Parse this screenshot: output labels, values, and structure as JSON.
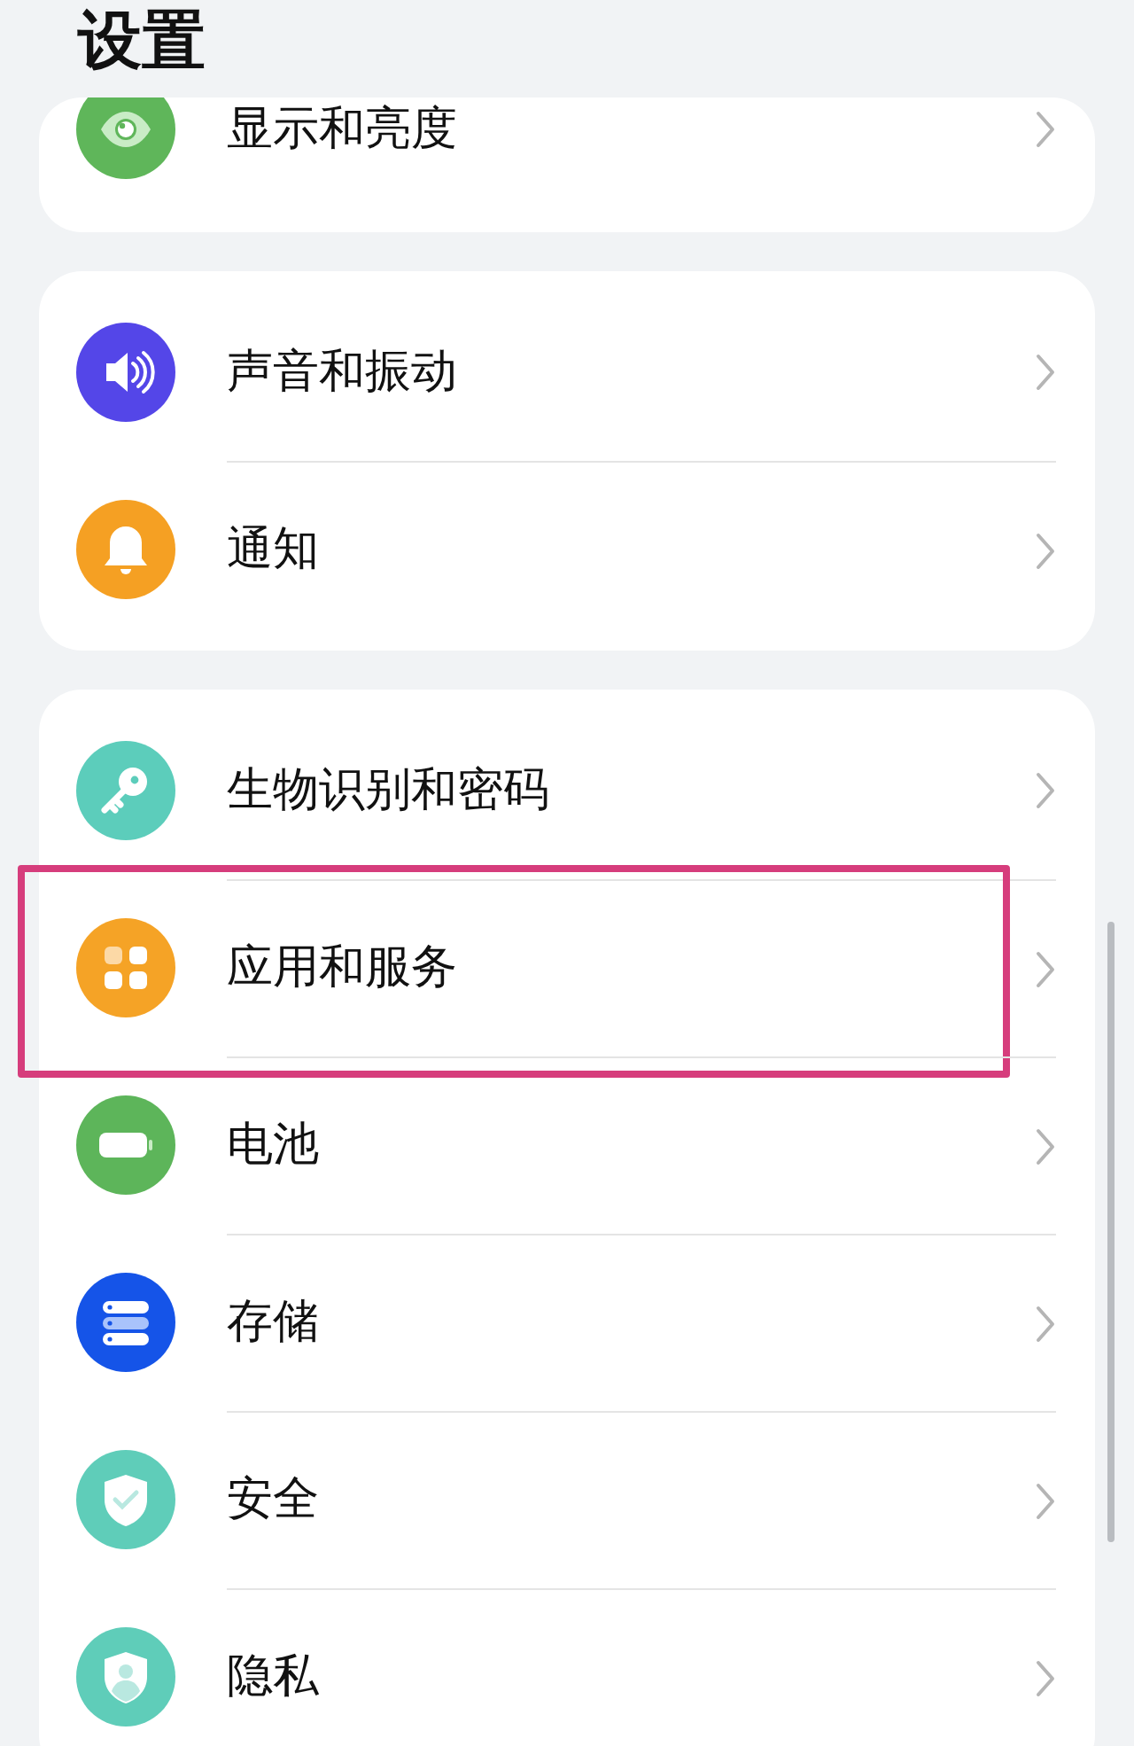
{
  "title": "设置",
  "groups": [
    {
      "items": [
        {
          "label": "显示和亮度",
          "color": "#5fb65a",
          "highlighted": false
        }
      ]
    },
    {
      "items": [
        {
          "label": "声音和振动",
          "color": "#5446e8",
          "highlighted": false
        },
        {
          "label": "通知",
          "color": "#f5a023",
          "highlighted": false
        }
      ]
    },
    {
      "items": [
        {
          "label": "生物识别和密码",
          "color": "#5ccdbb",
          "highlighted": false
        },
        {
          "label": "应用和服务",
          "color": "#f5a326",
          "highlighted": true
        },
        {
          "label": "电池",
          "color": "#5db55a",
          "highlighted": false
        },
        {
          "label": "存储",
          "color": "#1554e8",
          "highlighted": false
        },
        {
          "label": "安全",
          "color": "#5fcdb9",
          "highlighted": false
        },
        {
          "label": "隐私",
          "color": "#5fcdb9",
          "highlighted": false
        }
      ]
    }
  ]
}
